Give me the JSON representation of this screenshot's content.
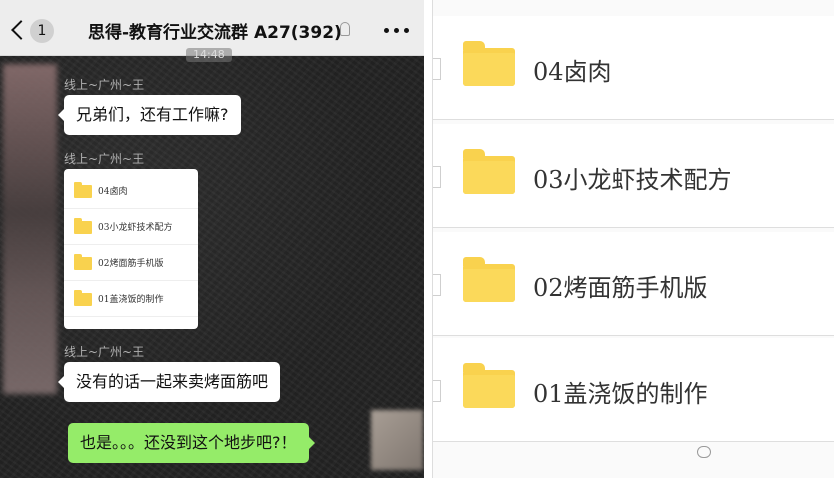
{
  "chat": {
    "back_badge": "1",
    "title": "思得-教育行业交流群 A27(392)",
    "time": "14:48",
    "messages": [
      {
        "sender": "线上~广州~王",
        "text": "兄弟们，还有工作嘛?"
      },
      {
        "sender": "线上~广州~王",
        "type": "file-card"
      },
      {
        "sender": "线上~广州~王",
        "text": "没有的话一起来卖烤面筋吧"
      },
      {
        "sender": "me",
        "text": "也是。。。还没到这个地步吧?！"
      }
    ],
    "file_card_items": [
      "04卤肉",
      "03小龙虾技术配方",
      "02烤面筋手机版",
      "01盖浇饭的制作"
    ]
  },
  "file_list": {
    "items": [
      "04卤肉",
      "03小龙虾技术配方",
      "02烤面筋手机版",
      "01盖浇饭的制作"
    ],
    "folder_color": "#f9d24e"
  },
  "colors": {
    "my_bubble": "#95ec69",
    "other_bubble": "#ffffff",
    "title_bar": "#ededed"
  }
}
